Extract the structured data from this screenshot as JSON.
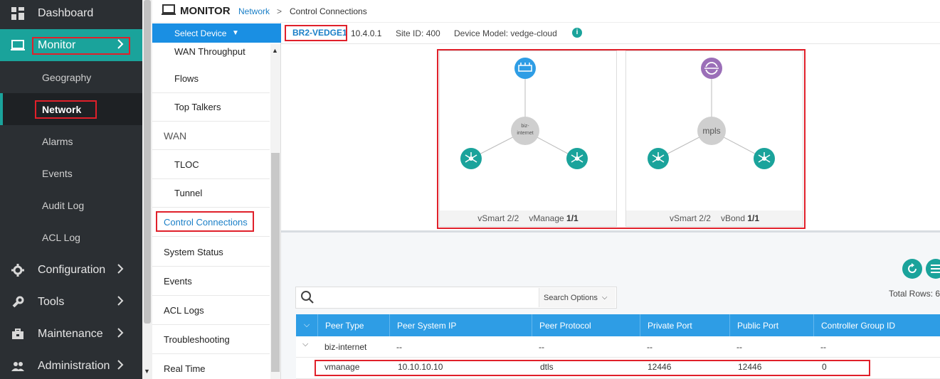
{
  "nav": {
    "dashboard": "Dashboard",
    "monitor": "Monitor",
    "geography": "Geography",
    "network": "Network",
    "alarms": "Alarms",
    "events": "Events",
    "audit_log": "Audit Log",
    "acl_log": "ACL Log",
    "configuration": "Configuration",
    "tools": "Tools",
    "maintenance": "Maintenance",
    "administration": "Administration"
  },
  "header": {
    "title": "MONITOR",
    "breadcrumb_parent": "Network",
    "breadcrumb_sep": ">",
    "breadcrumb_current": "Control Connections"
  },
  "sublist": {
    "select_device": "Select Device",
    "wan_throughput": "WAN Throughput",
    "flows": "Flows",
    "top_talkers": "Top Talkers",
    "wan": "WAN",
    "tloc": "TLOC",
    "tunnel": "Tunnel",
    "control_connections": "Control Connections",
    "system_status": "System Status",
    "events": "Events",
    "acl_logs": "ACL Logs",
    "troubleshooting": "Troubleshooting",
    "real_time": "Real Time"
  },
  "device": {
    "name": "BR2-VEDGE1",
    "ip": "10.4.0.1",
    "site_label": "Site ID:",
    "site_id": "400",
    "model_label": "Device Model:",
    "model": "vedge-cloud",
    "info_glyph": "i"
  },
  "topology": [
    {
      "transport": "biz-\ninternet",
      "footer_a_label": "vSmart",
      "footer_a_value": "2/2",
      "footer_b_label": "vManage",
      "footer_b_value": "1/1",
      "top_icon": "router-icon",
      "top_color": "#2e9de5"
    },
    {
      "transport": "mpls",
      "footer_a_label": "vSmart",
      "footer_a_value": "2/2",
      "footer_b_label": "vBond",
      "footer_b_value": "1/1",
      "top_icon": "sync-node-icon",
      "top_color": "#9b6fb8"
    }
  ],
  "colors": {
    "accent": "#1aa39b",
    "header_blue": "#2e9de5",
    "link": "#1a7fc7",
    "highlight": "#e0202a"
  },
  "search": {
    "placeholder": "",
    "options_label": "Search Options"
  },
  "table": {
    "total_rows": "Total Rows: 6",
    "columns": [
      "Peer Type",
      "Peer System IP",
      "Peer Protocol",
      "Private Port",
      "Public Port",
      "Controller Group ID"
    ],
    "group_row": [
      "biz-internet",
      "--",
      "--",
      "--",
      "--",
      "--"
    ],
    "rows": [
      [
        "vmanage",
        "10.10.10.10",
        "dtls",
        "12446",
        "12446",
        "0"
      ]
    ]
  }
}
